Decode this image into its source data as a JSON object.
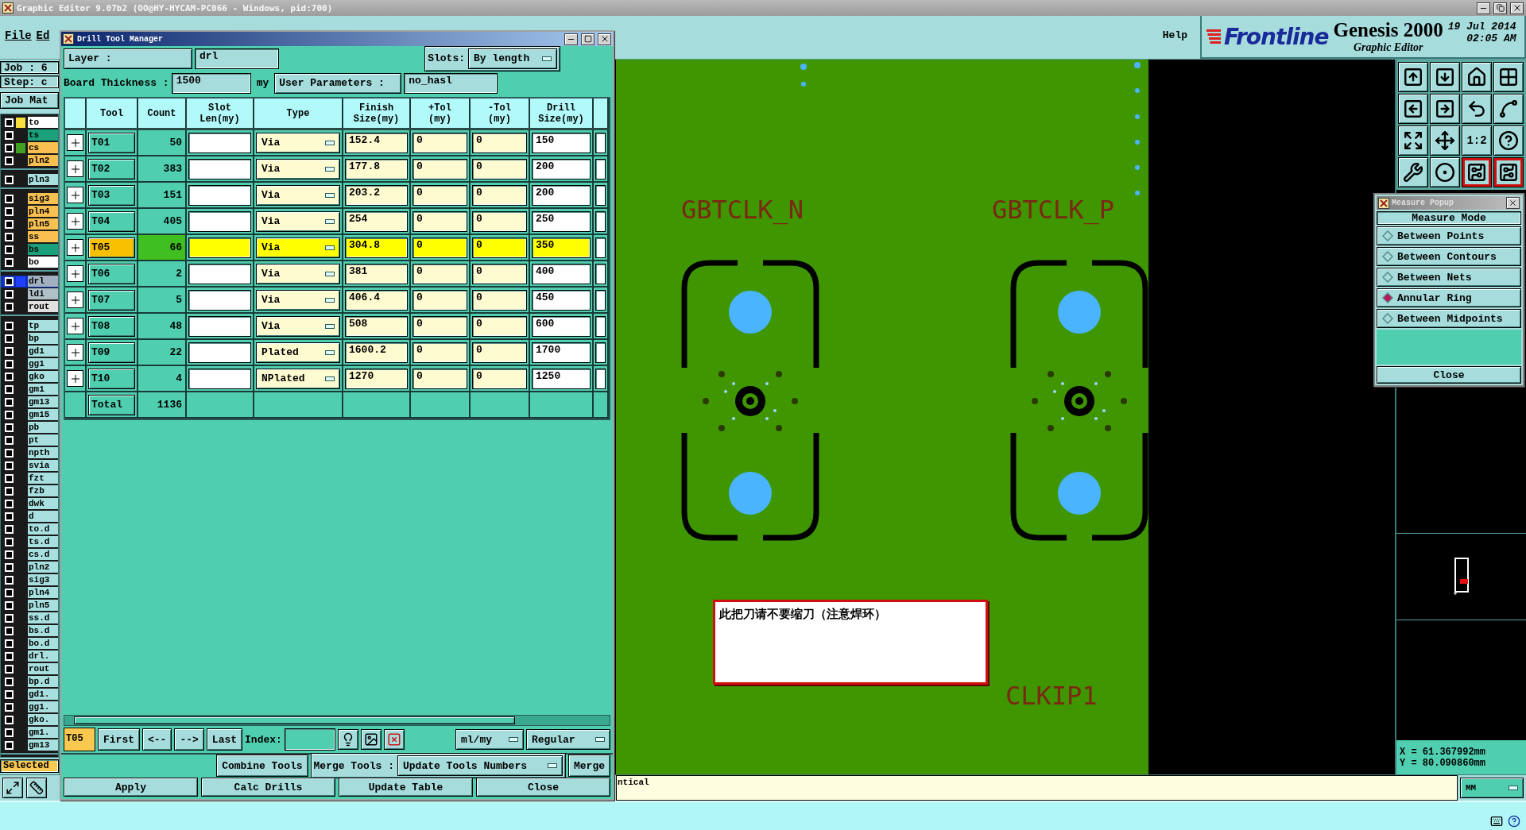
{
  "window": {
    "title": "Graphic Editor 9.07b2 (OO@HY-HYCAM-PC066 - Windows, pid:700)"
  },
  "menu": [
    {
      "label": "File"
    },
    {
      "label": "Ed"
    }
  ],
  "help": "Help",
  "brand": {
    "logo": "Frontline",
    "product": "Genesis 2000",
    "subtitle": "Graphic Editor",
    "date": "19 Jul 2014",
    "time": "02:05 AM"
  },
  "left_panel": {
    "job": "Job : 6",
    "step": "Step: c",
    "matrix_button": "Job Mat",
    "selected_label": "Selected",
    "layer_groups": [
      {
        "layers": [
          {
            "name": "to",
            "color": "#ffffff",
            "swatch": {
              "color": "#f8e040"
            },
            "selected": false
          },
          {
            "name": "ts",
            "color": "#1aa07a",
            "selected": false
          },
          {
            "name": "cs",
            "color": "#f8c050",
            "swatch": {
              "color": "#40a020"
            },
            "selected": false
          },
          {
            "name": "pln2",
            "color": "#f8c050",
            "selected": false
          }
        ]
      },
      {
        "layers": [
          {
            "name": "pln3",
            "color": "#a8e0e0",
            "selected": false
          }
        ]
      },
      {
        "layers": [
          {
            "name": "sig3",
            "color": "#f8c050",
            "selected": false
          },
          {
            "name": "pln4",
            "color": "#f8c050",
            "selected": false
          },
          {
            "name": "pln5",
            "color": "#f8c050",
            "selected": false
          },
          {
            "name": "ss",
            "color": "#f8c050",
            "selected": false
          },
          {
            "name": "bs",
            "color": "#1aa07a",
            "selected": false
          },
          {
            "name": "bo",
            "color": "#ffffff",
            "selected": false
          }
        ]
      },
      {
        "layers": [
          {
            "name": "drl",
            "color": "#a0b0c0",
            "swatch": {
              "color": "#2040ff"
            },
            "selected": true
          },
          {
            "name": "ldi",
            "color": "#b0c0c8",
            "selected": false
          },
          {
            "name": "rout",
            "color": "#e0e0e0",
            "selected": false
          }
        ]
      },
      {
        "layers": [
          {
            "name": "tp",
            "color": "#a8e0e0",
            "selected": false
          },
          {
            "name": "bp",
            "color": "#a8e0e0",
            "selected": false
          },
          {
            "name": "gd1",
            "color": "#a8e0e0",
            "selected": false
          },
          {
            "name": "gg1",
            "color": "#a8e0e0",
            "selected": false
          },
          {
            "name": "gko",
            "color": "#a8e0e0",
            "selected": false
          },
          {
            "name": "gm1",
            "color": "#a8e0e0",
            "selected": false
          },
          {
            "name": "gm13",
            "color": "#a8e0e0",
            "selected": false
          },
          {
            "name": "gm15",
            "color": "#a8e0e0",
            "selected": false
          },
          {
            "name": "pb",
            "color": "#a8e0e0",
            "selected": false
          },
          {
            "name": "pt",
            "color": "#a8e0e0",
            "selected": false
          },
          {
            "name": "npth",
            "color": "#a8e0e0",
            "selected": false
          },
          {
            "name": "svia",
            "color": "#a8e0e0",
            "selected": false
          },
          {
            "name": "fzt",
            "color": "#a8e0e0",
            "selected": false
          },
          {
            "name": "fzb",
            "color": "#a8e0e0",
            "selected": false
          },
          {
            "name": "dwk",
            "color": "#a8e0e0",
            "selected": false
          },
          {
            "name": "d",
            "color": "#a8e0e0",
            "selected": false
          },
          {
            "name": "to.d",
            "color": "#a8e0e0",
            "selected": false
          },
          {
            "name": "ts.d",
            "color": "#a8e0e0",
            "selected": false
          },
          {
            "name": "cs.d",
            "color": "#a8e0e0",
            "selected": false
          },
          {
            "name": "pln2",
            "color": "#a8e0e0",
            "selected": false
          },
          {
            "name": "sig3",
            "color": "#a8e0e0",
            "selected": false
          },
          {
            "name": "pln4",
            "color": "#a8e0e0",
            "selected": false
          },
          {
            "name": "pln5",
            "color": "#a8e0e0",
            "selected": false
          },
          {
            "name": "ss.d",
            "color": "#a8e0e0",
            "selected": false
          },
          {
            "name": "bs.d",
            "color": "#a8e0e0",
            "selected": false
          },
          {
            "name": "bo.d",
            "color": "#a8e0e0",
            "selected": false
          },
          {
            "name": "drl.",
            "color": "#a8e0e0",
            "selected": false
          },
          {
            "name": "rout",
            "color": "#a8e0e0",
            "selected": false
          },
          {
            "name": "bp.d",
            "color": "#a8e0e0",
            "selected": false
          },
          {
            "name": "gd1.",
            "color": "#a8e0e0",
            "selected": false
          },
          {
            "name": "gg1.",
            "color": "#a8e0e0",
            "selected": false
          },
          {
            "name": "gko.",
            "color": "#a8e0e0",
            "selected": false
          },
          {
            "name": "gm1.",
            "color": "#a8e0e0",
            "selected": false
          },
          {
            "name": "gm13",
            "color": "#a8e0e0",
            "selected": false
          }
        ]
      }
    ]
  },
  "drill_dialog": {
    "title": "Drill Tool Manager",
    "layer_label": "Layer :",
    "layer_value": "drl",
    "slots_label": "Slots:",
    "slots_value": "By length",
    "thickness_label": "Board Thickness :",
    "thickness_value": "1500",
    "thickness_unit": "my",
    "user_params_button": "User Parameters :",
    "user_params_value": "no_hasl",
    "columns": [
      "Tool",
      "Count",
      "Slot Len(my)",
      "Type",
      "Finish Size(my)",
      "+Tol (my)",
      "-Tol (my)",
      "Drill Size(my)"
    ],
    "rows": [
      {
        "tool": "T01",
        "count": "50",
        "type": "Via",
        "finish": "152.4",
        "plus_tol": "0",
        "minus_tol": "0",
        "drill": "150",
        "selected": false
      },
      {
        "tool": "T02",
        "count": "383",
        "type": "Via",
        "finish": "177.8",
        "plus_tol": "0",
        "minus_tol": "0",
        "drill": "200",
        "selected": false
      },
      {
        "tool": "T03",
        "count": "151",
        "type": "Via",
        "finish": "203.2",
        "plus_tol": "0",
        "minus_tol": "0",
        "drill": "200",
        "selected": false
      },
      {
        "tool": "T04",
        "count": "405",
        "type": "Via",
        "finish": "254",
        "plus_tol": "0",
        "minus_tol": "0",
        "drill": "250",
        "selected": false
      },
      {
        "tool": "T05",
        "count": "66",
        "type": "Via",
        "finish": "304.8",
        "plus_tol": "0",
        "minus_tol": "0",
        "drill": "350",
        "selected": true
      },
      {
        "tool": "T06",
        "count": "2",
        "type": "Via",
        "finish": "381",
        "plus_tol": "0",
        "minus_tol": "0",
        "drill": "400",
        "selected": false
      },
      {
        "tool": "T07",
        "count": "5",
        "type": "Via",
        "finish": "406.4",
        "plus_tol": "0",
        "minus_tol": "0",
        "drill": "450",
        "selected": false
      },
      {
        "tool": "T08",
        "count": "48",
        "type": "Via",
        "finish": "508",
        "plus_tol": "0",
        "minus_tol": "0",
        "drill": "600",
        "selected": false
      },
      {
        "tool": "T09",
        "count": "22",
        "type": "Plated",
        "finish": "1600.2",
        "plus_tol": "0",
        "minus_tol": "0",
        "drill": "1700",
        "selected": false
      },
      {
        "tool": "T10",
        "count": "4",
        "type": "NPlated",
        "finish": "1270",
        "plus_tol": "0",
        "minus_tol": "0",
        "drill": "1250",
        "selected": false
      }
    ],
    "total_label": "Total",
    "total_count": "1136",
    "current_tool": "T05",
    "nav_buttons": [
      "First",
      "<--",
      "-->",
      "Last"
    ],
    "index_label": "Index:",
    "units_value": "ml/my",
    "mode_value": "Regular",
    "combine_button": "Combine Tools",
    "merge_label": "Merge Tools :",
    "merge_option": "Update Tools Numbers",
    "merge_button": "Merge",
    "action_buttons": [
      "Apply",
      "Calc Drills",
      "Update Table",
      "Close"
    ]
  },
  "board": {
    "labels": [
      {
        "text": "GBTCLK_N"
      },
      {
        "text": "GBTCLK_P"
      },
      {
        "text": "CLKIP1"
      }
    ],
    "note": "此把刀请不要缩刀（注意焊环）"
  },
  "toolbar": [
    {
      "kind": "icon",
      "highlighted": false
    },
    {
      "kind": "icon",
      "highlighted": false
    },
    {
      "kind": "icon",
      "highlighted": false
    },
    {
      "kind": "icon",
      "highlighted": false
    },
    {
      "kind": "icon",
      "highlighted": false
    },
    {
      "kind": "icon",
      "highlighted": false
    },
    {
      "kind": "icon",
      "highlighted": false
    },
    {
      "kind": "icon",
      "highlighted": false
    },
    {
      "kind": "icon",
      "highlighted": false
    },
    {
      "kind": "icon",
      "highlighted": false
    },
    {
      "kind": "text",
      "label": "1:2",
      "highlighted": false
    },
    {
      "kind": "icon",
      "highlighted": false
    },
    {
      "kind": "icon",
      "highlighted": false
    },
    {
      "kind": "icon",
      "highlighted": false
    },
    {
      "kind": "icon",
      "highlighted": true
    },
    {
      "kind": "icon",
      "highlighted": true
    }
  ],
  "measure_popup": {
    "title": "Measure Popup",
    "heading": "Measure Mode",
    "options": [
      {
        "label": "Between Points",
        "selected": false
      },
      {
        "label": "Between Contours",
        "selected": false
      },
      {
        "label": "Between Nets",
        "selected": false
      },
      {
        "label": "Annular Ring",
        "selected": true
      },
      {
        "label": "Between Midpoints",
        "selected": false
      }
    ],
    "close_button": "Close"
  },
  "coordinates": {
    "x": "X = 61.367992mm",
    "y": "Y = 80.090860mm"
  },
  "message": "ntical",
  "unit_value": "MM"
}
